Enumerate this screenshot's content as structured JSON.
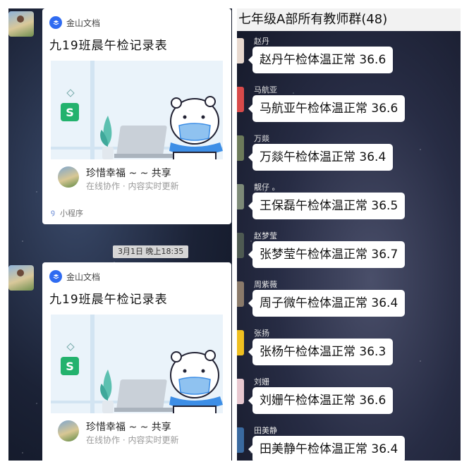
{
  "left_panel": {
    "cards": [
      {
        "brand": "金山文档",
        "title": "九19班晨午检记录表",
        "author_name": "珍惜幸福 ~ ~ 共享",
        "author_sub": "在线协作 · 内容实时更新",
        "mini_program": "小程序",
        "sheet_icon": "S"
      },
      {
        "brand": "金山文档",
        "title": "九19班晨午检记录表",
        "author_name": "珍惜幸福 ~ ~ 共享",
        "author_sub": "在线协作 · 内容实时更新",
        "sheet_icon": "S"
      }
    ],
    "timestamp": "3月1日 晚上18:35"
  },
  "right_panel": {
    "group_title": "七年级A部所有教师群(48)",
    "messages": [
      {
        "sender": "赵丹",
        "text": "赵丹午检体温正常 36.6",
        "avatar_color": "#e8d9cf"
      },
      {
        "sender": "马航亚",
        "text": "马航亚午检体温正常 36.6",
        "avatar_color": "#d84a4a"
      },
      {
        "sender": "万燚",
        "text": "万燚午检体温正常 36.4",
        "avatar_color": "#6c7a5a"
      },
      {
        "sender": "靓仔 。",
        "text": "王保磊午检体温正常 36.5",
        "avatar_color": "#7d8a78"
      },
      {
        "sender": "赵梦莹",
        "text": "张梦莹午检体温正常 36.7",
        "avatar_color": "#4e5a52"
      },
      {
        "sender": "周紫薇",
        "text": "周子微午检体温正常 36.4",
        "avatar_color": "#8a7a6a"
      },
      {
        "sender": "张扬",
        "text": "张杨午检体温正常 36.3",
        "avatar_color": "#f0c020"
      },
      {
        "sender": "刘姗",
        "text": "刘姗午检体温正常 36.6",
        "avatar_color": "#e8c8d0"
      },
      {
        "sender": "田美静",
        "text": "田美静午检体温正常 36.4",
        "avatar_color": "#3a6aa0"
      }
    ]
  },
  "colors": {
    "brand_blue": "#2f6bf1",
    "sheet_green": "#23b26d",
    "scarf_blue": "#3d8ee6"
  },
  "icons": [
    "kdocs-logo-icon",
    "spreadsheet-icon",
    "mini-program-icon",
    "avatar"
  ]
}
